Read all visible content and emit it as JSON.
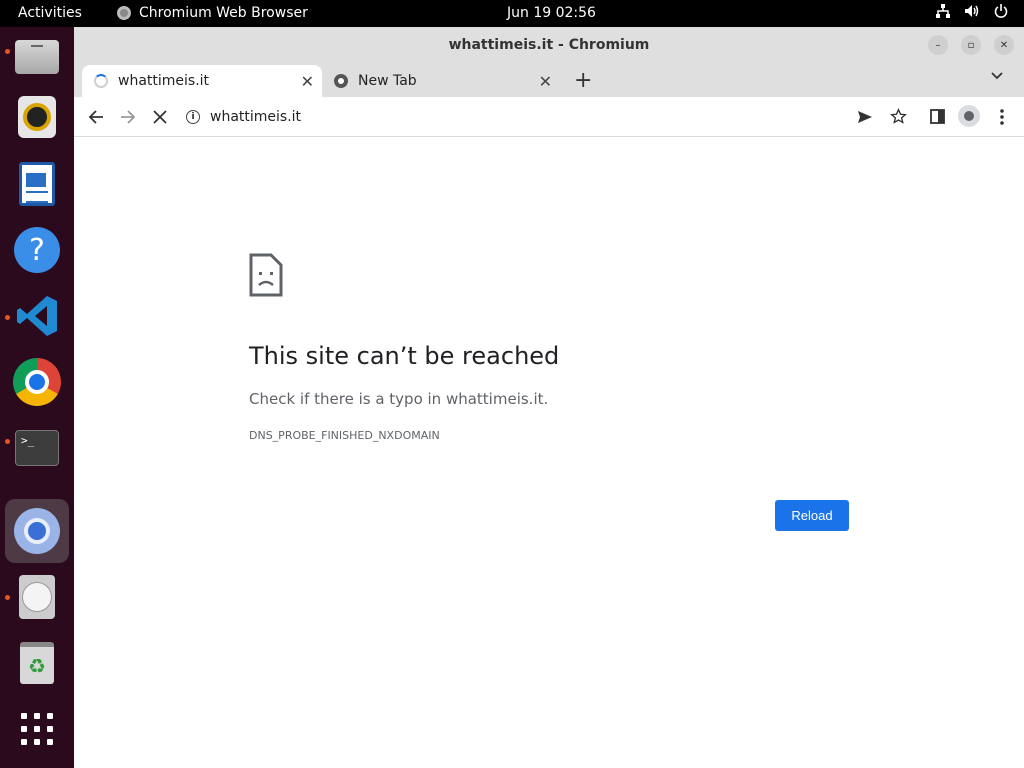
{
  "topbar": {
    "activities": "Activities",
    "app_name": "Chromium Web Browser",
    "clock": "Jun 19  02:56",
    "tray_icons": [
      "network-icon",
      "volume-icon",
      "power-icon"
    ]
  },
  "dock": {
    "items": [
      "files",
      "rhythmbox",
      "libreoffice-writer",
      "help",
      "vscode",
      "chrome",
      "terminal",
      "chromium",
      "disks",
      "trash",
      "show-apps"
    ]
  },
  "window": {
    "title": "whattimeis.it - Chromium"
  },
  "tabs": [
    {
      "label": "whattimeis.it",
      "active": true,
      "loading": true
    },
    {
      "label": "New Tab",
      "active": false
    }
  ],
  "toolbar": {
    "url": "whattimeis.it"
  },
  "error": {
    "title": "This site can’t be reached",
    "subtitle": "Check if there is a typo in whattimeis.it.",
    "code": "DNS_PROBE_FINISHED_NXDOMAIN",
    "reload_label": "Reload"
  },
  "colors": {
    "accent": "#1a73e8",
    "dock_bg": "#2c0a1d",
    "running_dot": "#e95420"
  }
}
